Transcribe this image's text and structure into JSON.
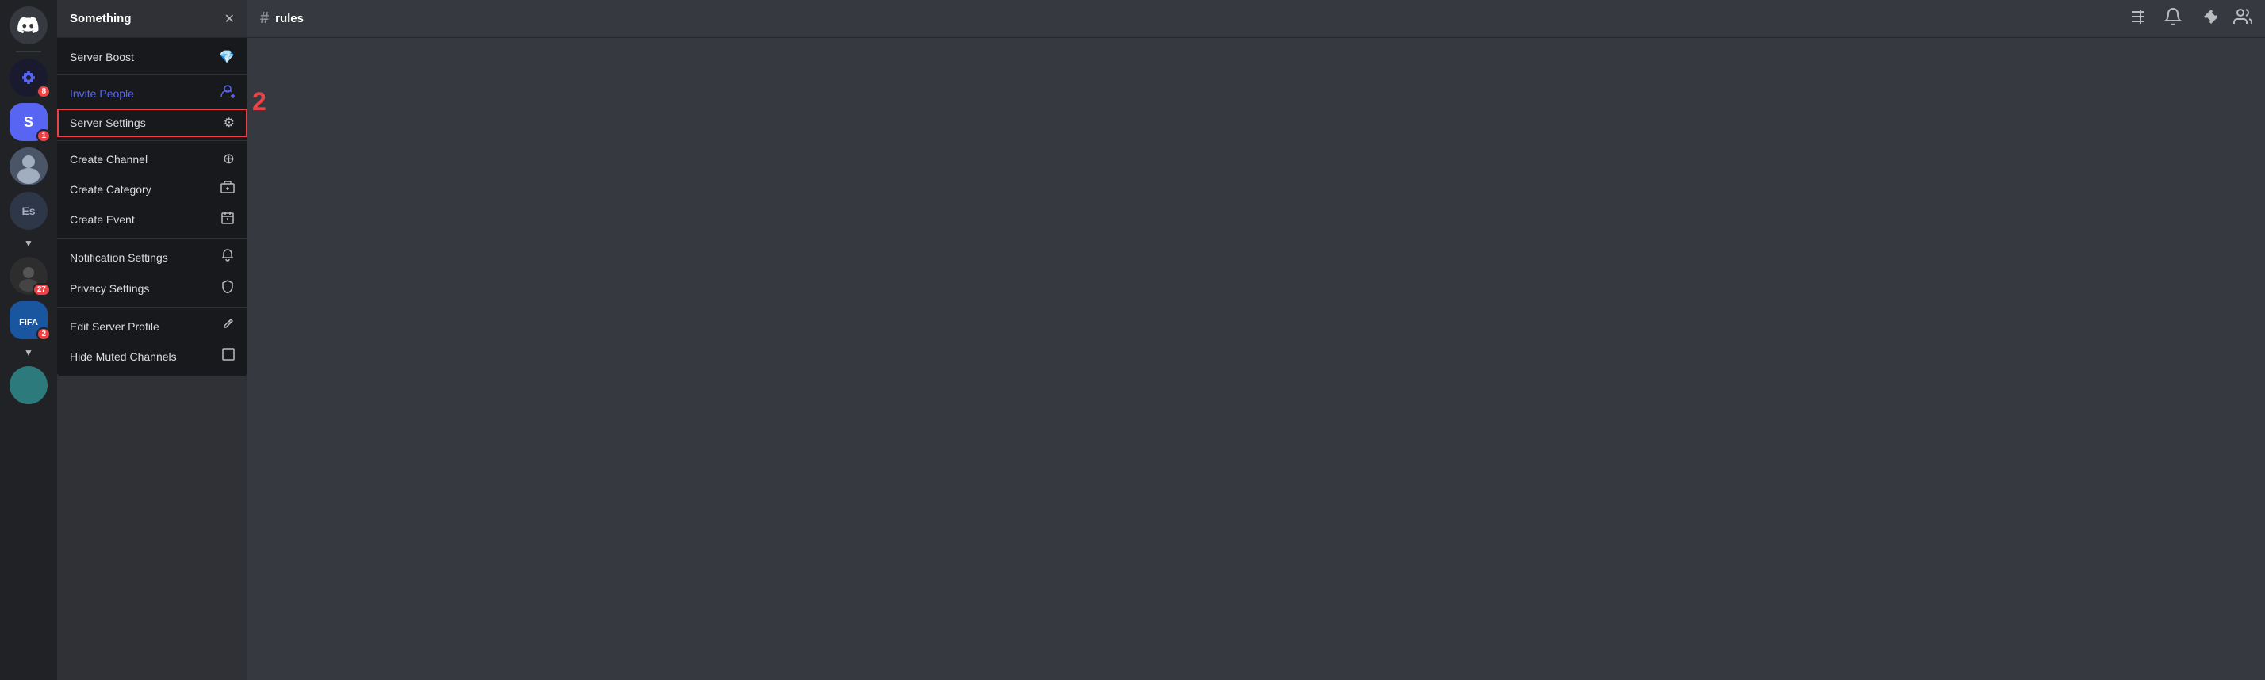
{
  "serverList": {
    "servers": [
      {
        "id": "discord-home",
        "type": "home",
        "label": "Discord Home"
      },
      {
        "id": "server-chip",
        "type": "avatar",
        "label": "Chip server",
        "bg": "#1a1a2e",
        "badge": "8"
      },
      {
        "id": "server-s",
        "type": "letter",
        "label": "S Server",
        "letter": "S",
        "badge": "1",
        "bg": "#5865f2"
      },
      {
        "id": "server-photo",
        "type": "photo",
        "label": "Photo server",
        "bg": "#4a5568"
      },
      {
        "id": "server-es",
        "type": "text",
        "label": "Es Server",
        "text": "Es",
        "bg": "#2d3748"
      },
      {
        "id": "server-dark",
        "type": "avatar2",
        "label": "Dark server",
        "bg": "#1a202c",
        "badge": "27"
      },
      {
        "id": "server-fifa",
        "type": "fifa",
        "label": "FIFA",
        "bg": "#2b6cb0",
        "badge": "2"
      },
      {
        "id": "server-teal",
        "type": "teal",
        "label": "Teal server",
        "bg": "#2c7a7b"
      }
    ]
  },
  "channelSidebar": {
    "serverName": "Something",
    "closeLabel": "✕"
  },
  "contextMenu": {
    "items": [
      {
        "id": "server-boost",
        "label": "Server Boost",
        "icon": "💎",
        "iconColor": "#ff73fa",
        "highlighted": false,
        "hasOutline": false
      },
      {
        "id": "invite-people",
        "label": "Invite People",
        "icon": "👤+",
        "iconColor": "#b9bbbe",
        "highlighted": true,
        "hasOutline": false
      },
      {
        "id": "server-settings",
        "label": "Server Settings",
        "icon": "⚙",
        "iconColor": "#b9bbbe",
        "highlighted": false,
        "hasOutline": true
      },
      {
        "id": "create-channel",
        "label": "Create Channel",
        "icon": "+",
        "iconColor": "#b9bbbe",
        "highlighted": false,
        "hasOutline": false
      },
      {
        "id": "create-category",
        "label": "Create Category",
        "icon": "📁+",
        "iconColor": "#b9bbbe",
        "highlighted": false,
        "hasOutline": false
      },
      {
        "id": "create-event",
        "label": "Create Event",
        "icon": "📅",
        "iconColor": "#b9bbbe",
        "highlighted": false,
        "hasOutline": false
      },
      {
        "id": "notification-settings",
        "label": "Notification Settings",
        "icon": "🔔",
        "iconColor": "#b9bbbe",
        "highlighted": false,
        "hasOutline": false
      },
      {
        "id": "privacy-settings",
        "label": "Privacy Settings",
        "icon": "🛡",
        "iconColor": "#b9bbbe",
        "highlighted": false,
        "hasOutline": false
      },
      {
        "id": "edit-server-profile",
        "label": "Edit Server Profile",
        "icon": "✏",
        "iconColor": "#b9bbbe",
        "highlighted": false,
        "hasOutline": false
      },
      {
        "id": "hide-muted-channels",
        "label": "Hide Muted Channels",
        "icon": "☐",
        "iconColor": "#b9bbbe",
        "highlighted": false,
        "hasOutline": false
      }
    ]
  },
  "topbar": {
    "channelHash": "#",
    "channelName": "rules",
    "icons": [
      {
        "id": "hashtag-icon",
        "symbol": "⊞",
        "label": "Add to server"
      },
      {
        "id": "bell-icon",
        "symbol": "🔔",
        "label": "Notification preferences"
      },
      {
        "id": "pin-icon",
        "symbol": "📌",
        "label": "Pinned messages"
      },
      {
        "id": "members-icon",
        "symbol": "👤",
        "label": "Member list"
      }
    ]
  },
  "annotation": {
    "text": "2"
  }
}
